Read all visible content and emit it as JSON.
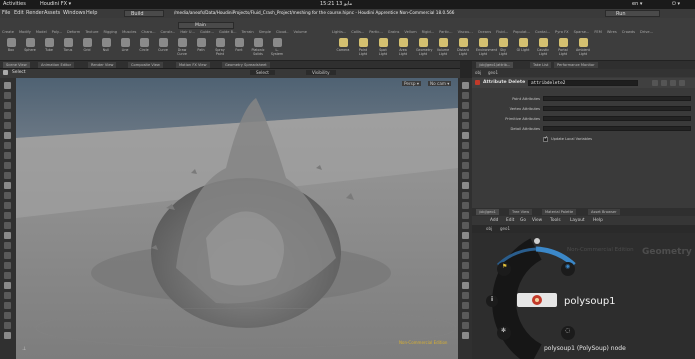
{
  "gnome": {
    "activities": "Activities",
    "app": "Houdini FX ▾",
    "clock": "15:21 13 مايو",
    "lang": "en ▾",
    "power": "⏻ ▾"
  },
  "menubar": {
    "items": [
      "File",
      "Edit",
      "Render",
      "Assets",
      "Windows",
      "Help"
    ],
    "build": "Build",
    "title": "/media/aneofs/Data/HoudiniProjects/Fluid_Crash_Project/meshing for the course.hipnc - Houdini Apprentice Non-Commercial 18.0.566",
    "main": "Main",
    "run": "Run"
  },
  "shelf": {
    "tabs_left": [
      "Create",
      "Modify",
      "Model",
      "Poly...",
      "Deform",
      "Texture",
      "Rigging",
      "Muscles",
      "Chara...",
      "Constr...",
      "Hair U...",
      "Guide...",
      "Guide B...",
      "Terrain",
      "Simple",
      "Cloud..",
      "Volume"
    ],
    "tabs_right": [
      "Lights...",
      "Collis...",
      "Partic...",
      "Grains",
      "Vellum",
      "Rigid...",
      "Partic...",
      "Viscou...",
      "Oceans",
      "Fluid...",
      "Populat...",
      "Contai...",
      "Pyro FX",
      "Sparse...",
      "FEM",
      "Wires",
      "Crowds",
      "Drive..."
    ],
    "tools_left": [
      "Box",
      "Sphere",
      "Tube",
      "Torus",
      "Grid",
      "Null",
      "Line",
      "Circle",
      "Curve",
      "Draw Curve",
      "Path",
      "Spray Paint",
      "Font",
      "Platonic Solids",
      "L-System"
    ],
    "tools_right": [
      "Camera",
      "Point Light",
      "Spot Light",
      "Area Light",
      "Geometry Light",
      "Volume Light",
      "Distant Light",
      "Environment Light",
      "Sky Light",
      "GI Light",
      "Caustic Light",
      "Portal Light",
      "Ambient Light"
    ]
  },
  "left_pane": {
    "tabs": [
      "Scene View",
      "Animation Editor",
      "Render View",
      "Composite View",
      "Motion FX View",
      "Geometry Spreadsheet"
    ],
    "path": [
      "obj",
      "geo1"
    ],
    "tool_select": "Select",
    "mode_select": "Select",
    "visibility": "Visibility",
    "persp": "Persp ▾",
    "cam": "No cam ▾",
    "watermark": "Non-Commercial Edition"
  },
  "right_pane": {
    "tabs": [
      "/obj/geo1/attrib...",
      "Take List",
      "Performance Monitor"
    ],
    "path": [
      "obj",
      "geo1"
    ],
    "node_type": "Attribute Delete",
    "node_name": "attribdelete2",
    "params": [
      {
        "label": "Point Attributes"
      },
      {
        "label": "Vertex Attributes"
      },
      {
        "label": "Primitive Attributes"
      },
      {
        "label": "Detail Attributes"
      }
    ],
    "checkbox_label": "Update Local Variables"
  },
  "network": {
    "tabs": [
      "/obj/geo1",
      "Tree View",
      "Material Palette",
      "Asset Browser"
    ],
    "menu": [
      "Add",
      "Edit",
      "Go",
      "View",
      "Tools",
      "Layout",
      "Help"
    ],
    "path": [
      "obj",
      "geo1"
    ],
    "context_label": "Geometry",
    "edition": "Non-Commercial Edition",
    "node_name": "polysoup1",
    "node_caption": "polysoup1 (PolySoup) node"
  },
  "colors": {
    "accent_blue": "#3b88c9",
    "radial_ring": "#161616",
    "node_red": "#c23a2a",
    "viewport_sky": "#5c6f82",
    "viewport_ground": "#8a8a8a"
  }
}
